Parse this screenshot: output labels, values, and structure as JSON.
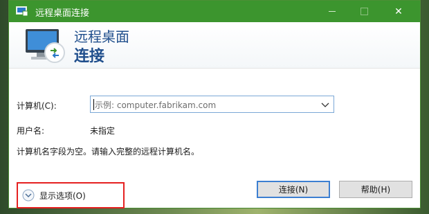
{
  "window": {
    "title": "远程桌面连接",
    "title_color": "#3c952e"
  },
  "icons": {
    "app": "remote-desktop-icon",
    "hero": "monitor-connection-icon",
    "minimize": "minimize-icon",
    "maximize": "maximize-icon",
    "close": "close-icon",
    "dropdown": "chevron-down-icon",
    "options": "expand-circle-icon"
  },
  "header": {
    "line1": "远程桌面",
    "line2": "连接"
  },
  "form": {
    "computer_label": "计算机(C):",
    "computer_value": "示例: computer.fabrikam.com",
    "user_label": "用户名:",
    "user_value": "未指定",
    "message": "计算机名字段为空。请输入完整的远程计算机名。"
  },
  "buttons": {
    "connect": "连接(N)",
    "help": "帮助(H)",
    "show_options": "显示选项(O)"
  },
  "title_buttons": {
    "close": "✕"
  }
}
